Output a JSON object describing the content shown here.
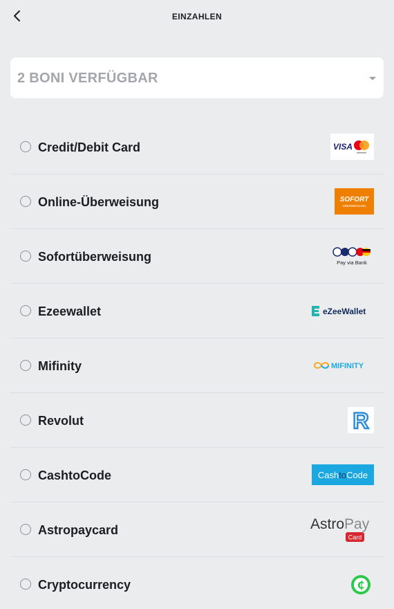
{
  "header": {
    "title": "EINZAHLEN",
    "back_icon": "chevron-left-icon"
  },
  "bonus": {
    "label": "2 BONI VERFÜGBAR",
    "caret_icon": "caret-down-icon"
  },
  "methods": [
    {
      "label": "Credit/Debit Card",
      "logo": "visa-mastercard-logo",
      "logo_text": "VISA"
    },
    {
      "label": "Online-Überweisung",
      "logo": "sofort-logo",
      "logo_text": "SOFORT",
      "logo_subtext": "ÜBERWEISUNG"
    },
    {
      "label": "Sofortüberweisung",
      "logo": "pay-via-bank-logo",
      "logo_text": "Pay via Bank"
    },
    {
      "label": "Ezeewallet",
      "logo": "ezeewallet-logo",
      "logo_text": "eZeeWallet"
    },
    {
      "label": "Mifinity",
      "logo": "mifinity-logo",
      "logo_text": "MIFINITY"
    },
    {
      "label": "Revolut",
      "logo": "revolut-logo",
      "logo_text": "R"
    },
    {
      "label": "CashtoCode",
      "logo": "cashtocode-logo",
      "logo_text_a": "Cash",
      "logo_text_b": "to",
      "logo_text_c": "Code"
    },
    {
      "label": "Astropaycard",
      "logo": "astropay-logo",
      "logo_text_a": "Astro",
      "logo_text_b": "Pay",
      "logo_text_c": "Card"
    },
    {
      "label": "Cryptocurrency",
      "logo": "crypto-logo",
      "logo_text": "₵"
    }
  ],
  "colors": {
    "background": "#ebecee",
    "sofort": "#ee7f00",
    "cashtocode": "#1ba8e0",
    "revolut": "#2e8bd8",
    "crypto": "#2ec84c",
    "astropay_red": "#d6262e"
  }
}
